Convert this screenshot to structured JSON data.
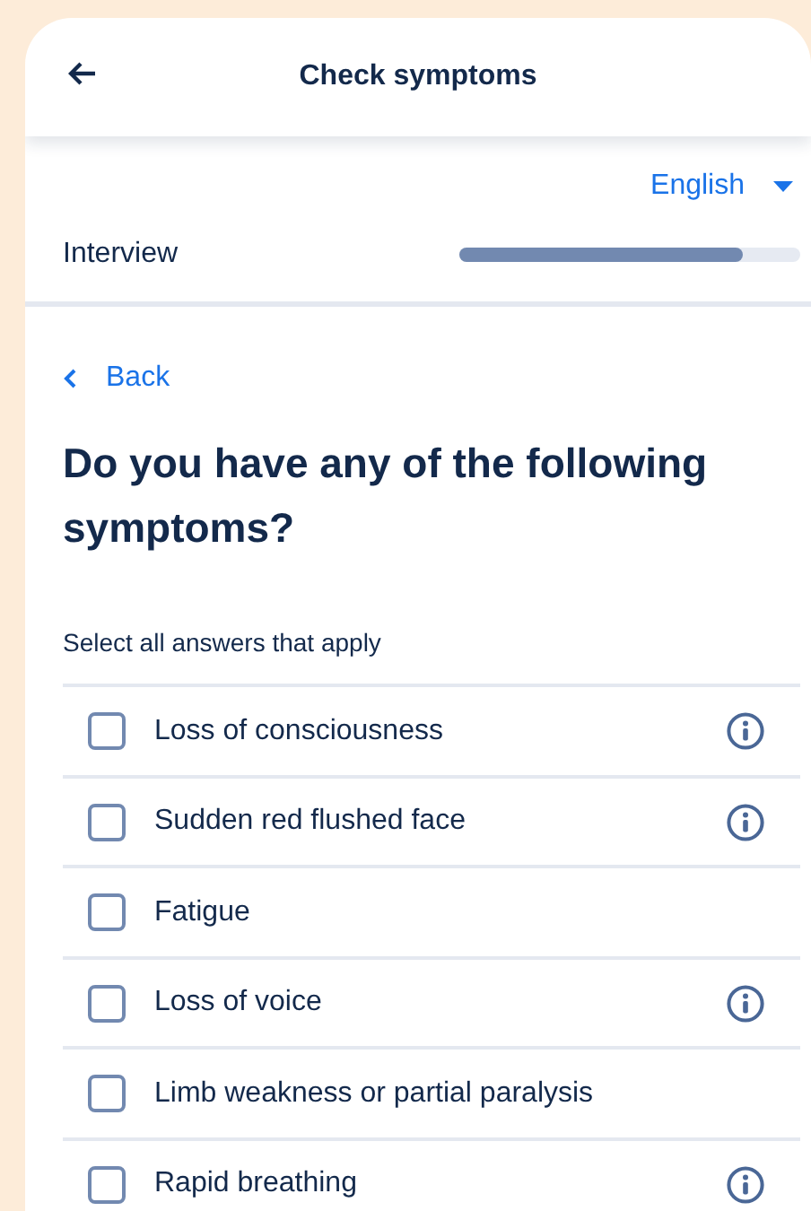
{
  "header": {
    "title": "Check symptoms"
  },
  "language": {
    "label": "English"
  },
  "progress": {
    "label": "Interview",
    "level": 0.83
  },
  "back_link": "Back",
  "question": "Do you have any of the following symptoms?",
  "hint": "Select all answers that apply",
  "options": [
    {
      "label": "Loss of consciousness",
      "checked": false,
      "info": true
    },
    {
      "label": "Sudden red flushed face",
      "checked": false,
      "info": true
    },
    {
      "label": "Fatigue",
      "checked": false,
      "info": false
    },
    {
      "label": "Loss of voice",
      "checked": false,
      "info": true
    },
    {
      "label": "Limb weakness or partial paralysis",
      "checked": false,
      "info": false
    },
    {
      "label": "Rapid breathing",
      "checked": false,
      "info": true
    }
  ]
}
